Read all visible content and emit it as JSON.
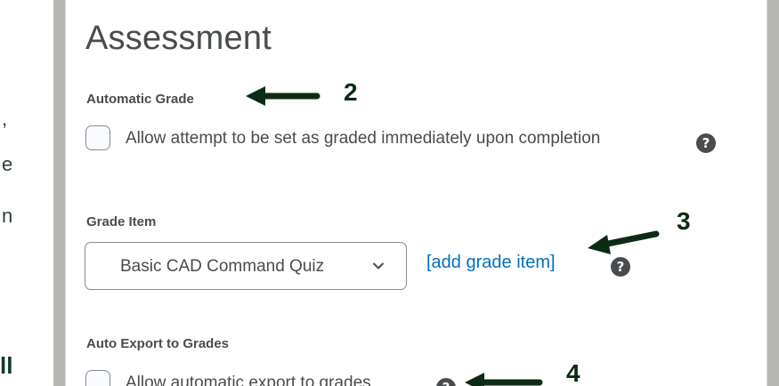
{
  "left_fragments": [
    {
      "text": ",",
      "bold": false
    },
    {
      "text": "e",
      "bold": false
    },
    {
      "text": "n",
      "bold": false
    },
    {
      "text": "ll",
      "bold": true
    }
  ],
  "assessment": {
    "title": "Assessment",
    "automatic_grade": {
      "label": "Automatic Grade",
      "checkbox_label": "Allow attempt to be set as graded immediately upon completion",
      "checked": false
    },
    "grade_item": {
      "label": "Grade Item",
      "selected": "Basic CAD Command Quiz",
      "add_link": "[add grade item]"
    },
    "auto_export": {
      "label": "Auto Export to Grades",
      "checkbox_label": "Allow automatic export to grades",
      "checked": false
    }
  },
  "annotations": [
    "2",
    "3",
    "4"
  ],
  "icons": {
    "help": "question-circle-icon",
    "dropdown": "chevron-down-icon"
  },
  "colors": {
    "text": "#494c4e",
    "link": "#006fbf",
    "frame": "#b6b6b2",
    "annotation": "#0c2b14"
  }
}
